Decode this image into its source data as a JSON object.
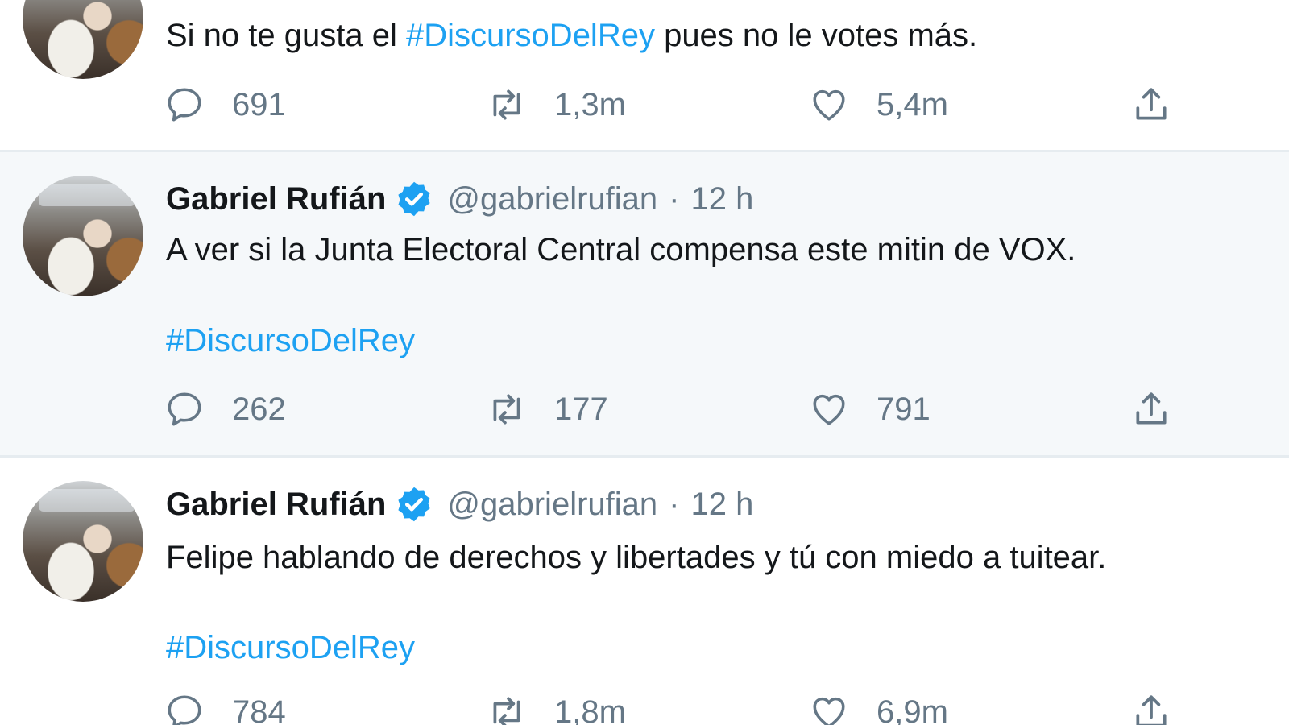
{
  "tweets": [
    {
      "text_before": "Si no te gusta el ",
      "hashtag": "#DiscursoDelRey",
      "text_after": " pues no le votes más.",
      "replies": "691",
      "retweets": "1,3m",
      "likes": "5,4m"
    },
    {
      "name": "Gabriel Rufián",
      "handle": "@gabrielrufian",
      "separator": "·",
      "time": "12 h",
      "text": "A ver si la Junta Electoral Central compensa este mitin de VOX.",
      "hashtag": "#DiscursoDelRey",
      "replies": "262",
      "retweets": "177",
      "likes": "791"
    },
    {
      "name": "Gabriel Rufián",
      "handle": "@gabrielrufian",
      "separator": "·",
      "time": "12 h",
      "text": "Felipe hablando de derechos y libertades y tú con miedo a tuitear.",
      "hashtag": "#DiscursoDelRey",
      "replies": "784",
      "retweets": "1,8m",
      "likes": "6,9m"
    }
  ],
  "colors": {
    "link": "#1da1f2",
    "muted": "#657786",
    "hover_bg": "#f5f8fa",
    "divider": "#e6ecf0"
  },
  "icons": [
    "reply-icon",
    "retweet-icon",
    "like-icon",
    "share-icon",
    "verified-badge-icon"
  ]
}
